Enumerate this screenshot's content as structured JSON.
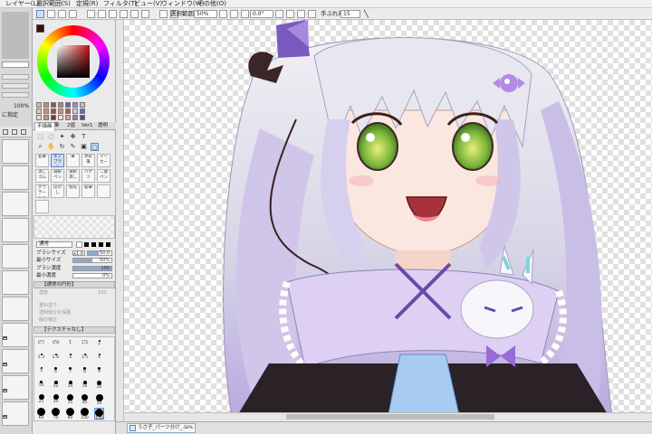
{
  "menu": [
    "レイヤー(L)",
    "選択範囲(S)",
    "定規(R)",
    "フィルタ(T)",
    "ビュー(V)",
    "ウィンドウ(W)",
    "その他(O)"
  ],
  "toolbar": {
    "selection_source_label": "選択範囲",
    "zoom_value": "50%",
    "rotation_value": "0.0°",
    "stabilizer_label": "手ぶれ補正",
    "stabilizer_value": "15"
  },
  "leftstrip": {
    "zoom_value": "100%",
    "opacity_label": "に指定"
  },
  "tool_tabs": [
    "不描画",
    "筆",
    "2値",
    "Ver1",
    "透明"
  ],
  "brushes": [
    {
      "label": "鉛筆"
    },
    {
      "label": "エアブラシ"
    },
    {
      "label": "筆"
    },
    {
      "label": "水彩筆"
    },
    {
      "label": "マーカー"
    },
    {
      "label": "消しゴム"
    },
    {
      "label": "選択ペン"
    },
    {
      "label": "選択消し"
    },
    {
      "label": "バケツ"
    },
    {
      "label": "二値ペン"
    },
    {
      "label": "グラデーション"
    },
    {
      "label": "ぼかし"
    },
    {
      "label": "指先"
    },
    {
      "label": "鉛筆"
    },
    {
      "label": ""
    },
    {
      "label": ""
    }
  ],
  "brush_props": {
    "blend_mode": "通常",
    "size_label": "ブラシサイズ",
    "size_multiplier": "x1.0",
    "size_value": "50.0",
    "min_size_label": "最小サイズ",
    "min_size_value": "50%",
    "density_label": "ブラシ濃度",
    "density_value": "100",
    "min_density_label": "最小濃度",
    "min_density_value": "0%",
    "shape_section": "【通常の円形】",
    "shape_label": "濃度",
    "shape_value": "100",
    "options": [
      "重ね塗り",
      "透明部分を保護",
      "線の補正"
    ],
    "texture_section": "【テクスチャなし】"
  },
  "brush_sizes": [
    [
      "0.7",
      "0.8",
      "1",
      "1.5",
      "2"
    ],
    [
      "2.3",
      "2.6",
      "3",
      "3.5",
      "4"
    ],
    [
      "5",
      "6",
      "7",
      "8",
      "9"
    ],
    [
      "10",
      "12",
      "14",
      "16",
      "20"
    ],
    [
      "25",
      "30",
      "35",
      "40",
      "50"
    ],
    [
      "60",
      "70",
      "80",
      "100",
      "120"
    ]
  ],
  "document_tab": {
    "name": "うさ子_パーツ分け_...",
    "zoom": "50%"
  },
  "colors": {
    "foreground": "#3a1010",
    "accent": "#5a87c8"
  },
  "swatches": [
    "#d6b8a8",
    "#c49078",
    "#8e5446",
    "#b47c8c",
    "#7c5aa8",
    "#9e8ed8",
    "#c8b6e6",
    "#e6c8c4",
    "#d48a86",
    "#a44a4a",
    "#e08a6a",
    "#b05a3e",
    "#d8c8f0",
    "#7868a8",
    "#f0d8d0",
    "#c89080",
    "#6a3a3a",
    "#f4e4dc",
    "#e8a090",
    "#a47aa8",
    "#584888"
  ]
}
